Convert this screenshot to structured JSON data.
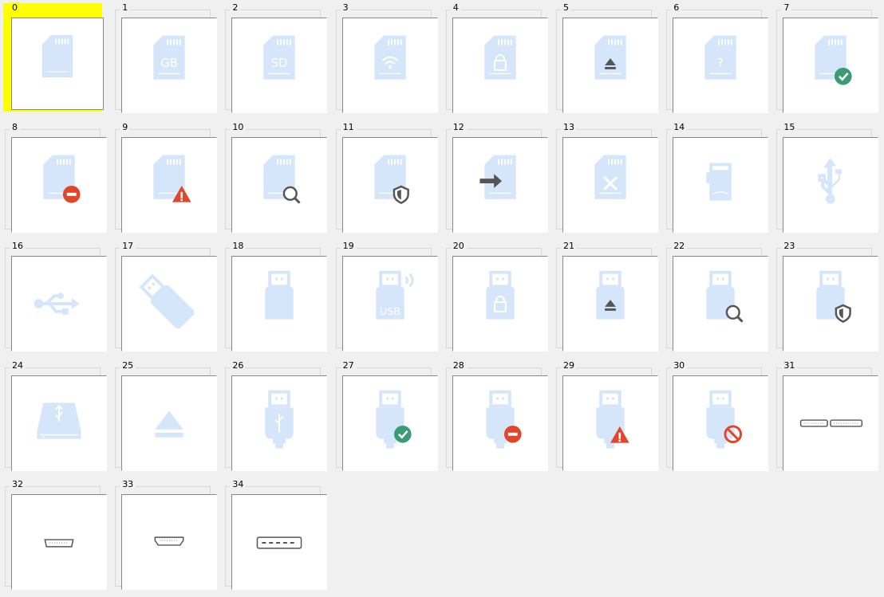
{
  "colors": {
    "icon_fill": "#d5e6fb",
    "check": "#3a9b74",
    "stop": "#e1462a",
    "warn": "#e1462a",
    "dark": "#555555",
    "selected_highlight": "#ffff00"
  },
  "selected_index": 0,
  "items": [
    {
      "label": "0",
      "icon": "sd-card-icon",
      "overlay": "",
      "text": ""
    },
    {
      "label": "1",
      "icon": "sd-card-icon",
      "overlay": "",
      "text": "GB"
    },
    {
      "label": "2",
      "icon": "sd-card-icon",
      "overlay": "",
      "text": "SD"
    },
    {
      "label": "3",
      "icon": "sd-card-wifi-icon",
      "overlay": "wifi",
      "text": ""
    },
    {
      "label": "4",
      "icon": "sd-card-lock-icon",
      "overlay": "lock",
      "text": ""
    },
    {
      "label": "5",
      "icon": "sd-card-eject-icon",
      "overlay": "eject",
      "text": ""
    },
    {
      "label": "6",
      "icon": "sd-card-question-icon",
      "overlay": "",
      "text": "?"
    },
    {
      "label": "7",
      "icon": "sd-card-check-icon",
      "overlay": "check",
      "text": ""
    },
    {
      "label": "8",
      "icon": "sd-card-stop-icon",
      "overlay": "stop",
      "text": ""
    },
    {
      "label": "9",
      "icon": "sd-card-warning-icon",
      "overlay": "warn",
      "text": ""
    },
    {
      "label": "10",
      "icon": "sd-card-search-icon",
      "overlay": "search",
      "text": ""
    },
    {
      "label": "11",
      "icon": "sd-card-shield-icon",
      "overlay": "shield",
      "text": ""
    },
    {
      "label": "12",
      "icon": "sd-card-arrow-icon",
      "overlay": "arrow",
      "text": ""
    },
    {
      "label": "13",
      "icon": "sd-card-tools-icon",
      "overlay": "tools",
      "text": ""
    },
    {
      "label": "14",
      "icon": "micro-sd-card-icon",
      "overlay": "",
      "text": ""
    },
    {
      "label": "15",
      "icon": "usb-symbol-vertical-icon",
      "overlay": "",
      "text": ""
    },
    {
      "label": "16",
      "icon": "usb-symbol-horizontal-icon",
      "overlay": "",
      "text": ""
    },
    {
      "label": "17",
      "icon": "usb-stick-diagonal-icon",
      "overlay": "",
      "text": ""
    },
    {
      "label": "18",
      "icon": "usb-stick-icon",
      "overlay": "",
      "text": ""
    },
    {
      "label": "19",
      "icon": "usb-stick-wireless-icon",
      "overlay": "",
      "text": "USB"
    },
    {
      "label": "20",
      "icon": "usb-stick-lock-icon",
      "overlay": "lock",
      "text": ""
    },
    {
      "label": "21",
      "icon": "usb-stick-eject-icon",
      "overlay": "eject",
      "text": ""
    },
    {
      "label": "22",
      "icon": "usb-stick-search-icon",
      "overlay": "search",
      "text": ""
    },
    {
      "label": "23",
      "icon": "usb-stick-shield-icon",
      "overlay": "shield",
      "text": ""
    },
    {
      "label": "24",
      "icon": "usb-drive-icon",
      "overlay": "",
      "text": ""
    },
    {
      "label": "25",
      "icon": "eject-icon",
      "overlay": "",
      "text": ""
    },
    {
      "label": "26",
      "icon": "usb-plug-icon",
      "overlay": "",
      "text": ""
    },
    {
      "label": "27",
      "icon": "usb-plug-check-icon",
      "overlay": "check",
      "text": ""
    },
    {
      "label": "28",
      "icon": "usb-plug-stop-icon",
      "overlay": "stop",
      "text": ""
    },
    {
      "label": "29",
      "icon": "usb-plug-warning-icon",
      "overlay": "warn",
      "text": ""
    },
    {
      "label": "30",
      "icon": "usb-plug-blocked-icon",
      "overlay": "blocked",
      "text": ""
    },
    {
      "label": "31",
      "icon": "usb3-micro-b-port-icon",
      "overlay": "",
      "text": ""
    },
    {
      "label": "32",
      "icon": "micro-usb-port-icon",
      "overlay": "",
      "text": ""
    },
    {
      "label": "33",
      "icon": "mini-usb-port-icon",
      "overlay": "",
      "text": ""
    },
    {
      "label": "34",
      "icon": "usb-a-port-icon",
      "overlay": "",
      "text": ""
    }
  ]
}
